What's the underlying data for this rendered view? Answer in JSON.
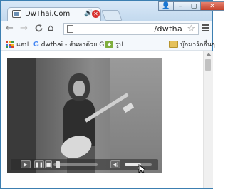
{
  "tab": {
    "title": "DwThai.Com",
    "speaker_glyph": "🔊",
    "close_glyph": "✕"
  },
  "window_controls": {
    "user_glyph": "👤",
    "minimize_glyph": "–",
    "maximize_glyph": "▢",
    "close_glyph": "✕"
  },
  "toolbar": {
    "back_glyph": "←",
    "forward_glyph": "→",
    "reload_glyph": "C",
    "home_glyph": "⌂",
    "url": "/dwtha",
    "star_glyph": "☆"
  },
  "bookmarks": {
    "apps_label": "แอป",
    "items": [
      {
        "label": "dwthai - ค้นหาด้วย G...",
        "icon": "google-icon"
      },
      {
        "label": "รูป",
        "icon": "picture-icon"
      }
    ],
    "other_label": "บุ๊กมาร์กอื่นๆ"
  },
  "player": {
    "play_glyph": "▶",
    "pause_glyph": "❚❚",
    "stop_glyph": "■",
    "volume_glyph": "◀)",
    "fullscreen_glyph": "▲",
    "progress": 0.05,
    "volume": 0.6
  },
  "colors": {
    "frame": "#3c7fb1",
    "close_button": "#c4412b",
    "tab_close": "#d8312f"
  }
}
